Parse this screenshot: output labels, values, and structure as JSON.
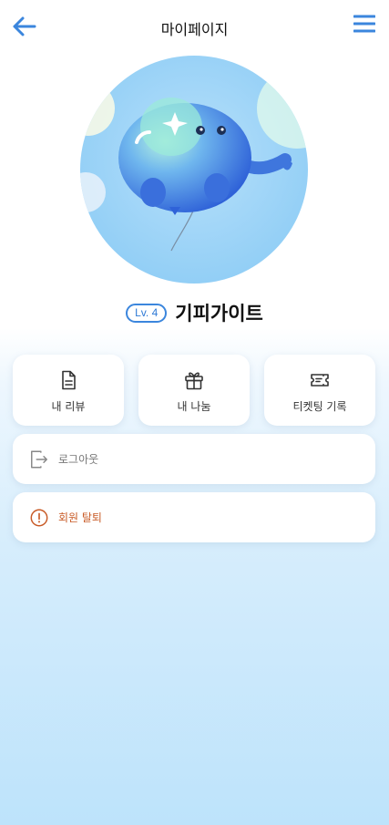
{
  "header": {
    "title": "마이페이지",
    "back_icon": "arrow-left-icon",
    "menu_icon": "hamburger-menu-icon"
  },
  "profile": {
    "level": "Lv. 4",
    "nickname": "기피가이트",
    "avatar": "elephant-balloon-avatar"
  },
  "cards": [
    {
      "label": "내 리뷰",
      "icon": "document-icon"
    },
    {
      "label": "내 나눔",
      "icon": "gift-icon"
    },
    {
      "label": "티켓팅 기록",
      "icon": "ticket-icon"
    }
  ],
  "actions": {
    "logout": {
      "label": "로그아웃",
      "icon": "logout-icon"
    },
    "withdraw": {
      "label": "회원 탈퇴",
      "icon": "warning-icon"
    }
  },
  "colors": {
    "accent": "#3b86dd",
    "danger": "#c85a26",
    "bg_bottom": "#bde3fb"
  }
}
